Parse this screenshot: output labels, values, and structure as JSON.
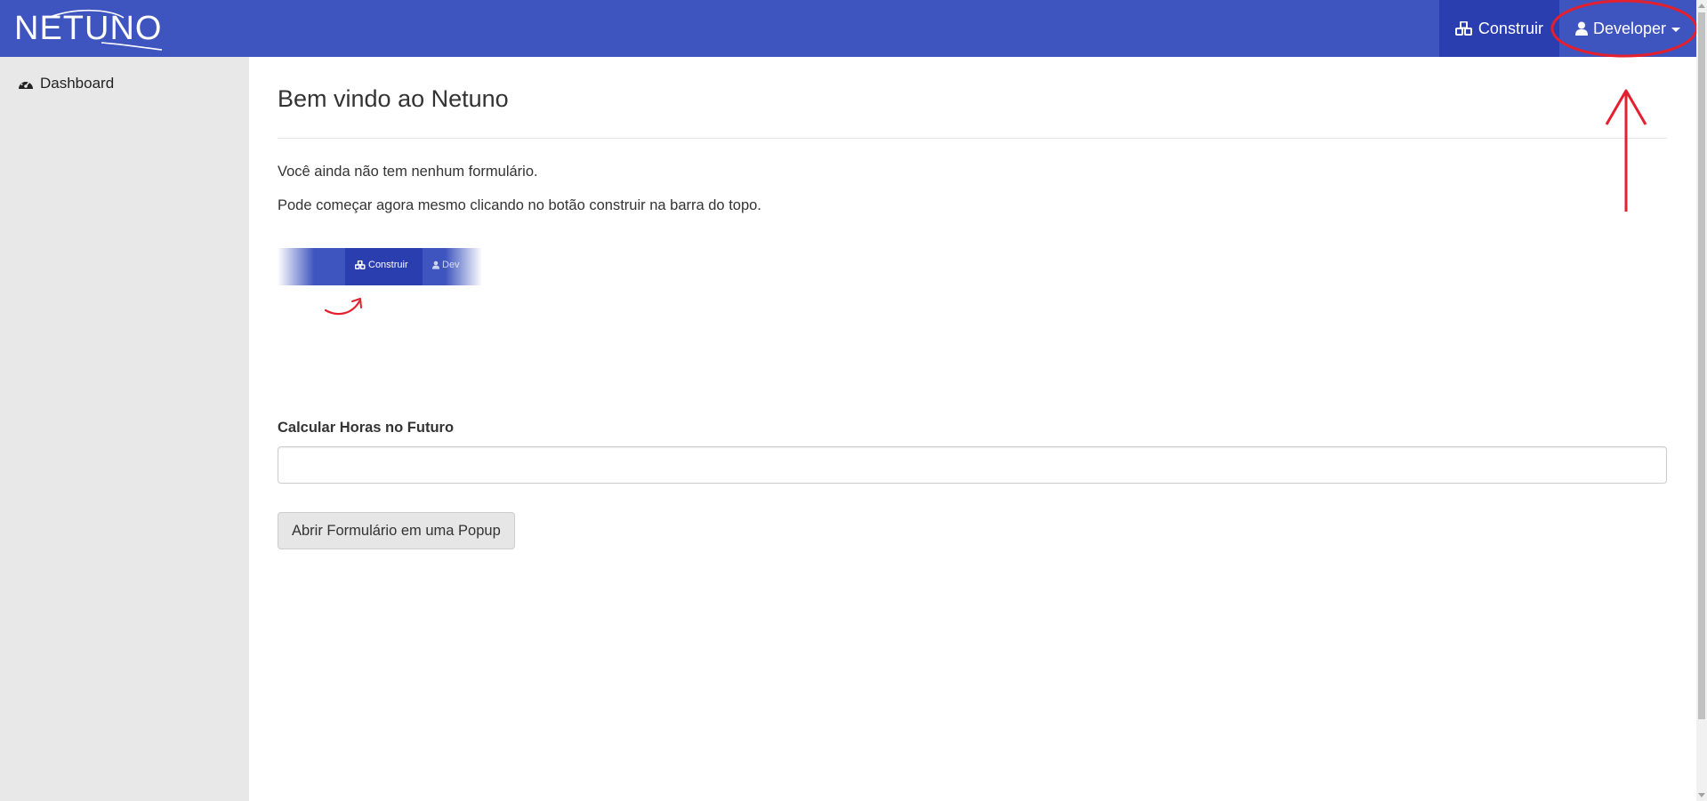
{
  "header": {
    "logo_text": "NETUNO",
    "nav": {
      "build_label": "Construir",
      "user_label": "Developer"
    },
    "colors": {
      "bar": "#3e55bf",
      "active": "#2a3eb0"
    }
  },
  "sidebar": {
    "items": [
      {
        "label": "Dashboard",
        "icon": "dashboard-icon"
      }
    ]
  },
  "main": {
    "title": "Bem vindo ao Netuno",
    "paragraphs": [
      "Você ainda não tem nenhum formulário.",
      "Pode começar agora mesmo clicando no botão construir na barra do topo."
    ],
    "hint_image": {
      "build_label": "Construir",
      "user_label": "Dev"
    },
    "field": {
      "label": "Calcular Horas no Futuro",
      "value": "",
      "placeholder": ""
    },
    "popup_button_label": "Abrir Formulário em uma Popup"
  },
  "annotation": {
    "color": "#e5202e",
    "icons": [
      "red-circle-highlight",
      "red-arrow-up"
    ]
  }
}
